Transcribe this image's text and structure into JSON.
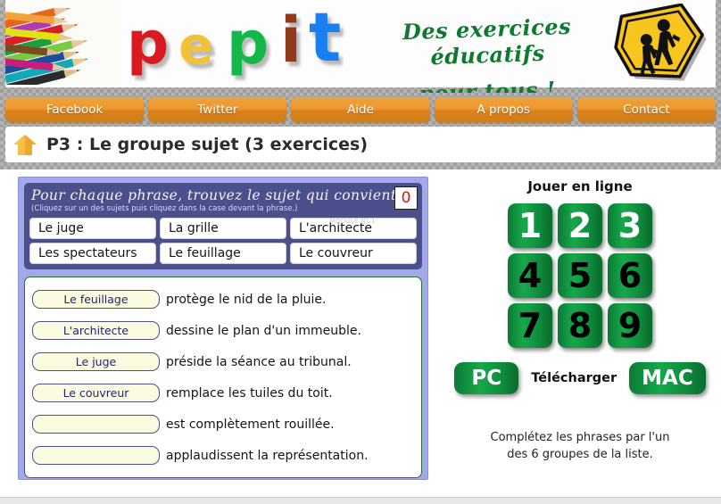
{
  "banner": {
    "logo_letters": [
      {
        "char": "p",
        "color": "#d81b20"
      },
      {
        "char": "e",
        "color": "#f2c236"
      },
      {
        "char": "p",
        "color": "#14b84a"
      },
      {
        "char": "i",
        "color": "#8f3a1c"
      },
      {
        "char": "t",
        "color": "#1a7ff0"
      }
    ],
    "slogan_line1": "Des exercices éducatifs",
    "slogan_line2": "pour tous !",
    "pencils_alt": "colored-pencils-photo",
    "roadsign_alt": "school-crossing-sign"
  },
  "nav": {
    "items": [
      {
        "label": "Facebook"
      },
      {
        "label": "Twitter"
      },
      {
        "label": "Aide"
      },
      {
        "label": "A propos"
      },
      {
        "label": "Contact"
      }
    ]
  },
  "title_bar": {
    "home_icon": "house-icon",
    "title": "P3 : Le groupe sujet (3 exercices)"
  },
  "exercise": {
    "instruction": "Pour chaque phrase, trouvez le sujet qui convient.",
    "sub_instruction": "(Cliquez sur un des sujets puis cliquez dans la case devant la phrase.)",
    "module_label": "MODULE N° 1",
    "score": "0",
    "choices": [
      "Le juge",
      "La grille",
      "L'architecte",
      "Les spectateurs",
      "Le feuillage",
      "Le couvreur"
    ],
    "sentences": [
      {
        "slot": "Le feuillage",
        "text": "protège le nid de la pluie."
      },
      {
        "slot": "L'architecte",
        "text": "dessine le plan d'un immeuble."
      },
      {
        "slot": "Le juge",
        "text": "préside la séance au tribunal."
      },
      {
        "slot": "Le couvreur",
        "text": "remplace les tuiles du toit."
      },
      {
        "slot": "",
        "text": "est complètement rouillée."
      },
      {
        "slot": "",
        "text": "applaudissent la représentation."
      }
    ]
  },
  "right_panel": {
    "play_title": "Jouer en ligne",
    "numbers": [
      {
        "label": "1",
        "style": "white"
      },
      {
        "label": "2",
        "style": "white"
      },
      {
        "label": "3",
        "style": "white"
      },
      {
        "label": "4",
        "style": "black"
      },
      {
        "label": "5",
        "style": "black"
      },
      {
        "label": "6",
        "style": "black"
      },
      {
        "label": "7",
        "style": "black"
      },
      {
        "label": "8",
        "style": "black"
      },
      {
        "label": "9",
        "style": "black"
      }
    ],
    "pc_label": "PC",
    "download_label": "Télécharger",
    "mac_label": "MAC",
    "hint_line1": "Complétez les phrases par l'un",
    "hint_line2": "des 6 groupes de la liste."
  },
  "colors": {
    "nav_orange": "#eb9a2f",
    "applet_border": "#a3a8e8",
    "header_navy": "#4b4f8c",
    "green_button": "#0e8c3c",
    "score_red": "#e51414",
    "slot_yellow": "#fbfbe0"
  }
}
